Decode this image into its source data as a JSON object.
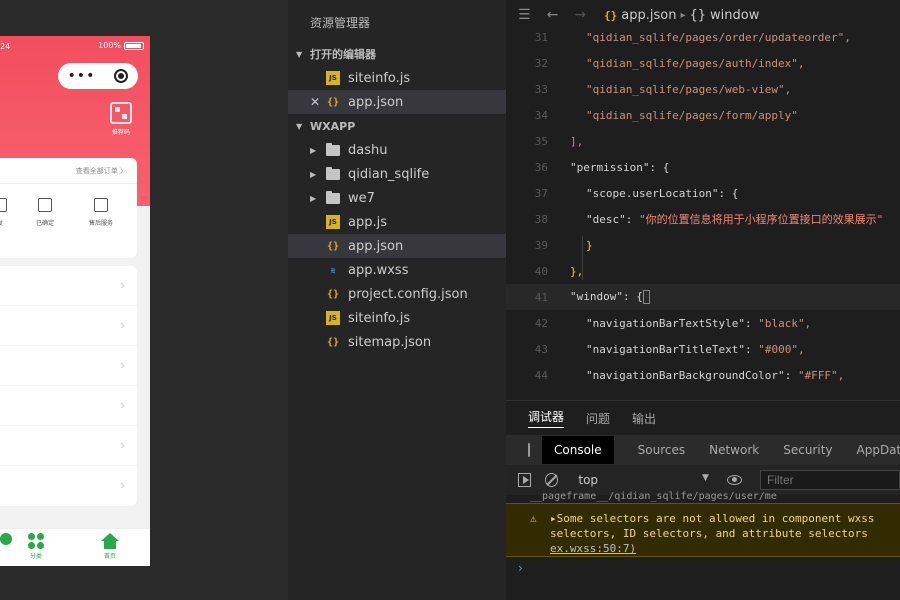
{
  "simulator": {
    "status_time": "24",
    "status_battery": "100%",
    "qr_label": "推荐码",
    "order_all": "查看全部订单 〉",
    "order_items": [
      "发",
      "已确定",
      "售后服务"
    ],
    "tabs": [
      "",
      "分类",
      "首页"
    ]
  },
  "explorer": {
    "title": "资源管理器",
    "open_editors_label": "打开的编辑器",
    "open_editors": [
      "siteinfo.js",
      "app.json"
    ],
    "project_label": "WXAPP",
    "folders": [
      "dashu",
      "qidian_sqlife",
      "we7"
    ],
    "files": [
      "app.js",
      "app.json",
      "app.wxss",
      "project.config.json",
      "siteinfo.js",
      "sitemap.json"
    ]
  },
  "editor": {
    "breadcrumb_file": "app.json",
    "breadcrumb_node": "window",
    "lines": [
      {
        "n": "31",
        "text": "\"qidian_sqlife/pages/order/updateorder\","
      },
      {
        "n": "32",
        "text": "\"qidian_sqlife/pages/auth/index\","
      },
      {
        "n": "33",
        "text": "\"qidian_sqlife/pages/web-view\","
      },
      {
        "n": "34",
        "text": "\"qidian_sqlife/pages/form/apply\""
      },
      {
        "n": "35",
        "text": "],"
      },
      {
        "n": "36",
        "key": "\"permission\"",
        "rest": ": {"
      },
      {
        "n": "37",
        "key": "\"scope.userLocation\"",
        "rest": ": {"
      },
      {
        "n": "38",
        "key": "\"desc\"",
        "rest": ": ",
        "val": "\"你的位置信息将用于小程序位置接口的效果展示\""
      },
      {
        "n": "39",
        "text": "}"
      },
      {
        "n": "40",
        "text": "},"
      },
      {
        "n": "41",
        "key": "\"window\"",
        "rest": ": {"
      },
      {
        "n": "42",
        "key": "\"navigationBarTextStyle\"",
        "rest": ": ",
        "val": "\"black\","
      },
      {
        "n": "43",
        "key": "\"navigationBarTitleText\"",
        "rest": ": ",
        "val": "\"#000\","
      },
      {
        "n": "44",
        "key": "\"navigationBarBackgroundColor\"",
        "rest": ": ",
        "val": "\"#FFF\","
      }
    ]
  },
  "debug": {
    "panel_tabs": [
      "调试器",
      "问题",
      "输出"
    ],
    "dev_tabs": [
      "Console",
      "Sources",
      "Network",
      "Security",
      "AppData"
    ],
    "context": "top",
    "filter_placeholder": "Filter",
    "prev_log": "__pageframe__/qidian_sqlife/pages/user/me",
    "warn_line1": "▸Some selectors are not allowed in component wxss",
    "warn_line2": "selectors, ID selectors, and attribute selectors",
    "warn_line3": "ex.wxss:50:7)",
    "prompt": "›"
  },
  "colors": {
    "header_red": "#f24e5e",
    "tab_green": "#2aa84a",
    "json_yellow": "#d7b31d",
    "string": "#ce9178",
    "warn_bg": "#332b00"
  }
}
